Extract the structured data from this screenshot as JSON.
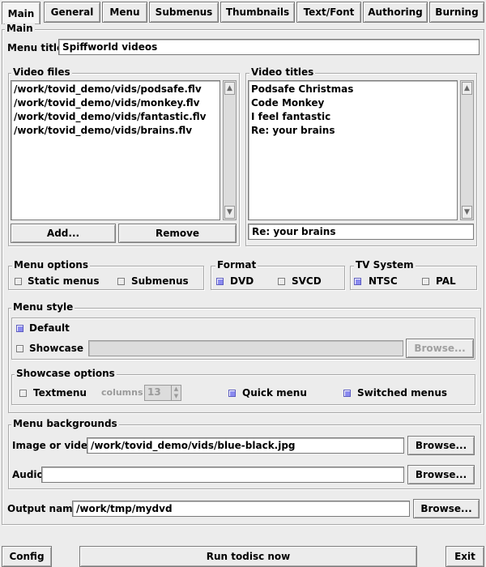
{
  "tabs": [
    {
      "label": "Main",
      "active": true
    },
    {
      "label": "General"
    },
    {
      "label": "Menu"
    },
    {
      "label": "Submenus"
    },
    {
      "label": "Thumbnails"
    },
    {
      "label": "Text/Font"
    },
    {
      "label": "Authoring"
    },
    {
      "label": "Burning"
    }
  ],
  "main": {
    "legend": "Main",
    "menu_title_label": "Menu title",
    "menu_title_value": "Spiffworld videos",
    "video_files": {
      "legend": "Video files",
      "items": [
        "/work/tovid_demo/vids/podsafe.flv",
        "/work/tovid_demo/vids/monkey.flv",
        "/work/tovid_demo/vids/fantastic.flv",
        "/work/tovid_demo/vids/brains.flv"
      ],
      "add_label": "Add...",
      "remove_label": "Remove"
    },
    "video_titles": {
      "legend": "Video titles",
      "items": [
        "Podsafe Christmas",
        "Code Monkey",
        "I feel fantastic",
        "Re: your brains"
      ],
      "edit_value": "Re: your brains"
    },
    "menu_options": {
      "legend": "Menu options",
      "static": "Static menus",
      "submenus": "Submenus"
    },
    "format": {
      "legend": "Format",
      "dvd": "DVD",
      "svcd": "SVCD",
      "selected": "DVD"
    },
    "tv_system": {
      "legend": "TV System",
      "ntsc": "NTSC",
      "pal": "PAL",
      "selected": "NTSC"
    },
    "menu_style": {
      "legend": "Menu style",
      "default": "Default",
      "showcase": "Showcase",
      "browse": "Browse...",
      "selected": "Default"
    },
    "showcase_options": {
      "legend": "Showcase options",
      "textmenu": "Textmenu",
      "columns_label": "columns",
      "columns_value": "13",
      "quick_menu": "Quick menu",
      "switched_menus": "Switched menus"
    },
    "menu_backgrounds": {
      "legend": "Menu backgrounds",
      "image_label": "Image or video",
      "image_value": "/work/tovid_demo/vids/blue-black.jpg",
      "audio_label": "Audio",
      "audio_value": "",
      "browse": "Browse..."
    },
    "output_name_label": "Output name",
    "output_name_value": "/work/tmp/mydvd",
    "output_browse": "Browse..."
  },
  "footer": {
    "config": "Config",
    "run": "Run todisc now",
    "exit": "Exit"
  },
  "colors": {
    "background": "#ececec",
    "checked": "#8b8bef",
    "field": "#ffffff"
  }
}
